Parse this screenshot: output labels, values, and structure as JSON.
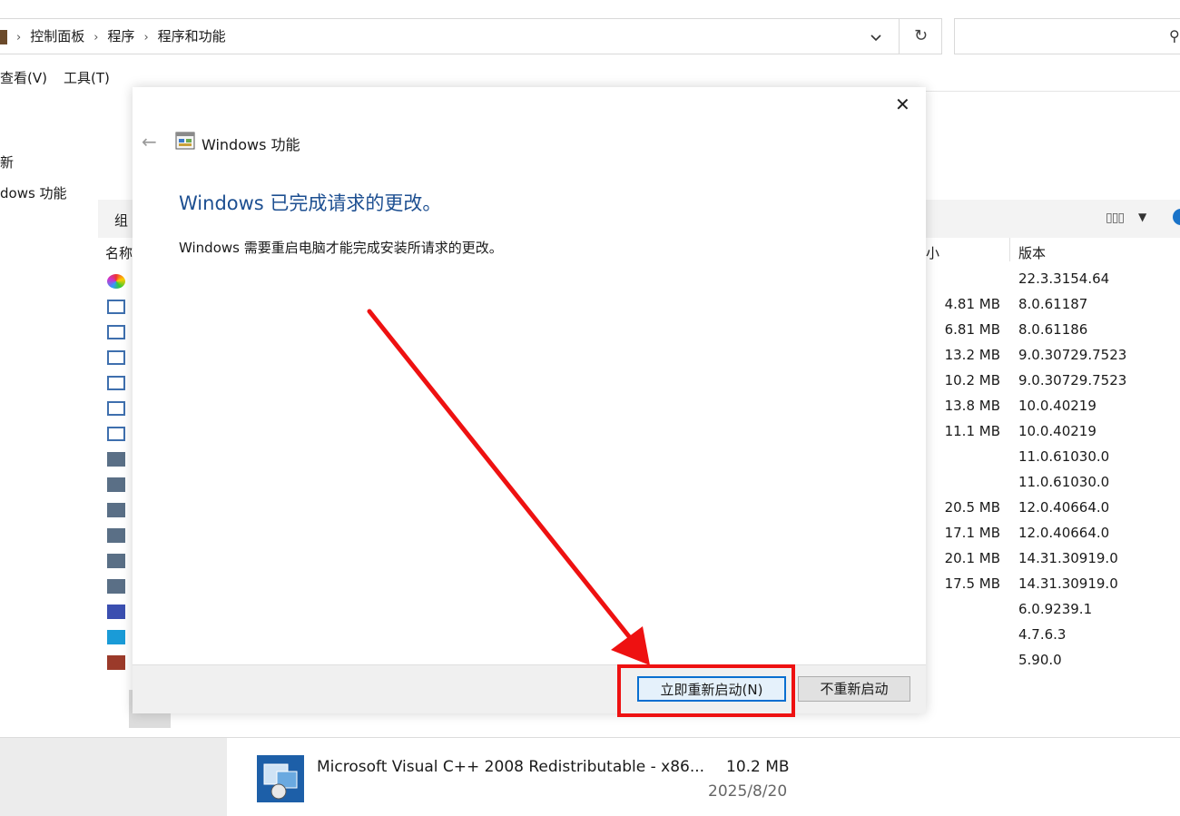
{
  "address_bar": {
    "breadcrumbs": [
      "控制面板",
      "程序",
      "程序和功能"
    ],
    "separator": "›",
    "refresh_icon": "refresh-icon",
    "dropdown_icon": "chevron-down-icon"
  },
  "search": {
    "icon": "search-icon"
  },
  "menu": {
    "view": "查看(V)",
    "tools": "工具(T)"
  },
  "left_pane": {
    "item1": "新",
    "item2": "dows 功能"
  },
  "list_toolbar": {
    "organize": "组"
  },
  "columns": {
    "name": "名称",
    "size": "小",
    "version": "版本"
  },
  "programs": [
    {
      "icon": "app-icon-colorful",
      "size": "",
      "version": "22.3.3154.64"
    },
    {
      "icon": "installer-icon",
      "size": "4.81 MB",
      "version": "8.0.61187"
    },
    {
      "icon": "installer-icon",
      "size": "6.81 MB",
      "version": "8.0.61186"
    },
    {
      "icon": "installer-icon",
      "size": "13.2 MB",
      "version": "9.0.30729.7523"
    },
    {
      "icon": "installer-icon",
      "size": "10.2 MB",
      "version": "9.0.30729.7523"
    },
    {
      "icon": "installer-icon",
      "size": "13.8 MB",
      "version": "10.0.40219"
    },
    {
      "icon": "installer-icon",
      "size": "11.1 MB",
      "version": "10.0.40219"
    },
    {
      "icon": "setup-icon",
      "size": "",
      "version": "11.0.61030.0"
    },
    {
      "icon": "setup-icon",
      "size": "",
      "version": "11.0.61030.0"
    },
    {
      "icon": "setup-icon",
      "size": "20.5 MB",
      "version": "12.0.40664.0"
    },
    {
      "icon": "setup-icon",
      "size": "17.1 MB",
      "version": "12.0.40664.0"
    },
    {
      "icon": "setup-icon",
      "size": "20.1 MB",
      "version": "14.31.30919.0"
    },
    {
      "icon": "setup-icon",
      "size": "17.5 MB",
      "version": "14.31.30919.0"
    },
    {
      "icon": "vb-icon",
      "size": "",
      "version": "6.0.9239.1"
    },
    {
      "icon": "app-icon-blue",
      "size": "",
      "version": "4.7.6.3"
    },
    {
      "icon": "archive-icon",
      "size": "",
      "version": "5.90.0"
    }
  ],
  "details": {
    "name": "Microsoft Visual C++ 2008 Redistributable - x86...",
    "size": "10.2 MB",
    "date": "2025/8/20"
  },
  "dialog": {
    "title": "Windows 功能",
    "heading": "Windows 已完成请求的更改。",
    "message": "Windows 需要重启电脑才能完成安装所请求的更改。",
    "restart_button": "立即重新启动(N)",
    "later_button": "不重新启动",
    "close_icon": "close-icon",
    "back_icon": "back-arrow-icon"
  },
  "annotation": {
    "color": "#ee1111"
  },
  "colors": {
    "heading_blue": "#1d4f91",
    "button_focus": "#0a6fd0"
  }
}
